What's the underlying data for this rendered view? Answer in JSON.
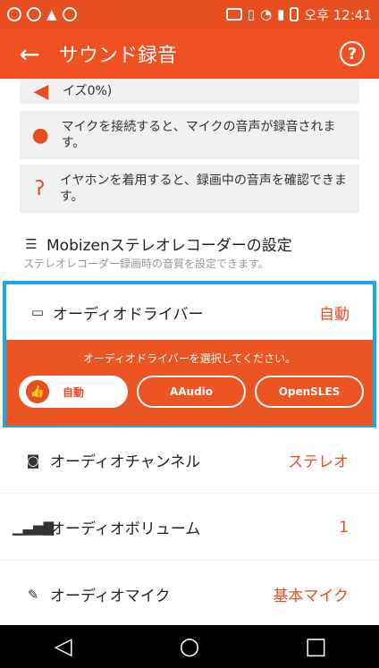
{
  "status": {
    "time": "오후 12:41"
  },
  "appbar": {
    "title": "サウンド録音",
    "help": "?"
  },
  "tips": [
    {
      "text": "イズ0%)"
    },
    {
      "text": "マイクを接続すると、マイクの音声が録音されます。"
    },
    {
      "text": "イヤホンを着用すると、録画中の音声を確認できます。"
    }
  ],
  "stereo": {
    "heading": "Mobizenステレオレコーダーの設定",
    "sub": "ステレオレコーダー録画時の音質を設定できます。"
  },
  "driver": {
    "label": "オーディオドライバー",
    "value": "自動",
    "prompt": "オーディオドライバーを選択してください。",
    "options": [
      "自動",
      "AAudio",
      "OpenSLES"
    ],
    "selected_index": 0
  },
  "rows": [
    {
      "label": "オーディオチャンネル",
      "value": "ステレオ"
    },
    {
      "label": "オーディオボリューム",
      "value": "1"
    },
    {
      "label": "オーディオマイク",
      "value": "基本マイク"
    }
  ],
  "nav": {
    "back": "◁",
    "home": "○",
    "recents": "□"
  },
  "colors": {
    "accent": "#e94e20",
    "highlight": "#1aa9e6"
  }
}
